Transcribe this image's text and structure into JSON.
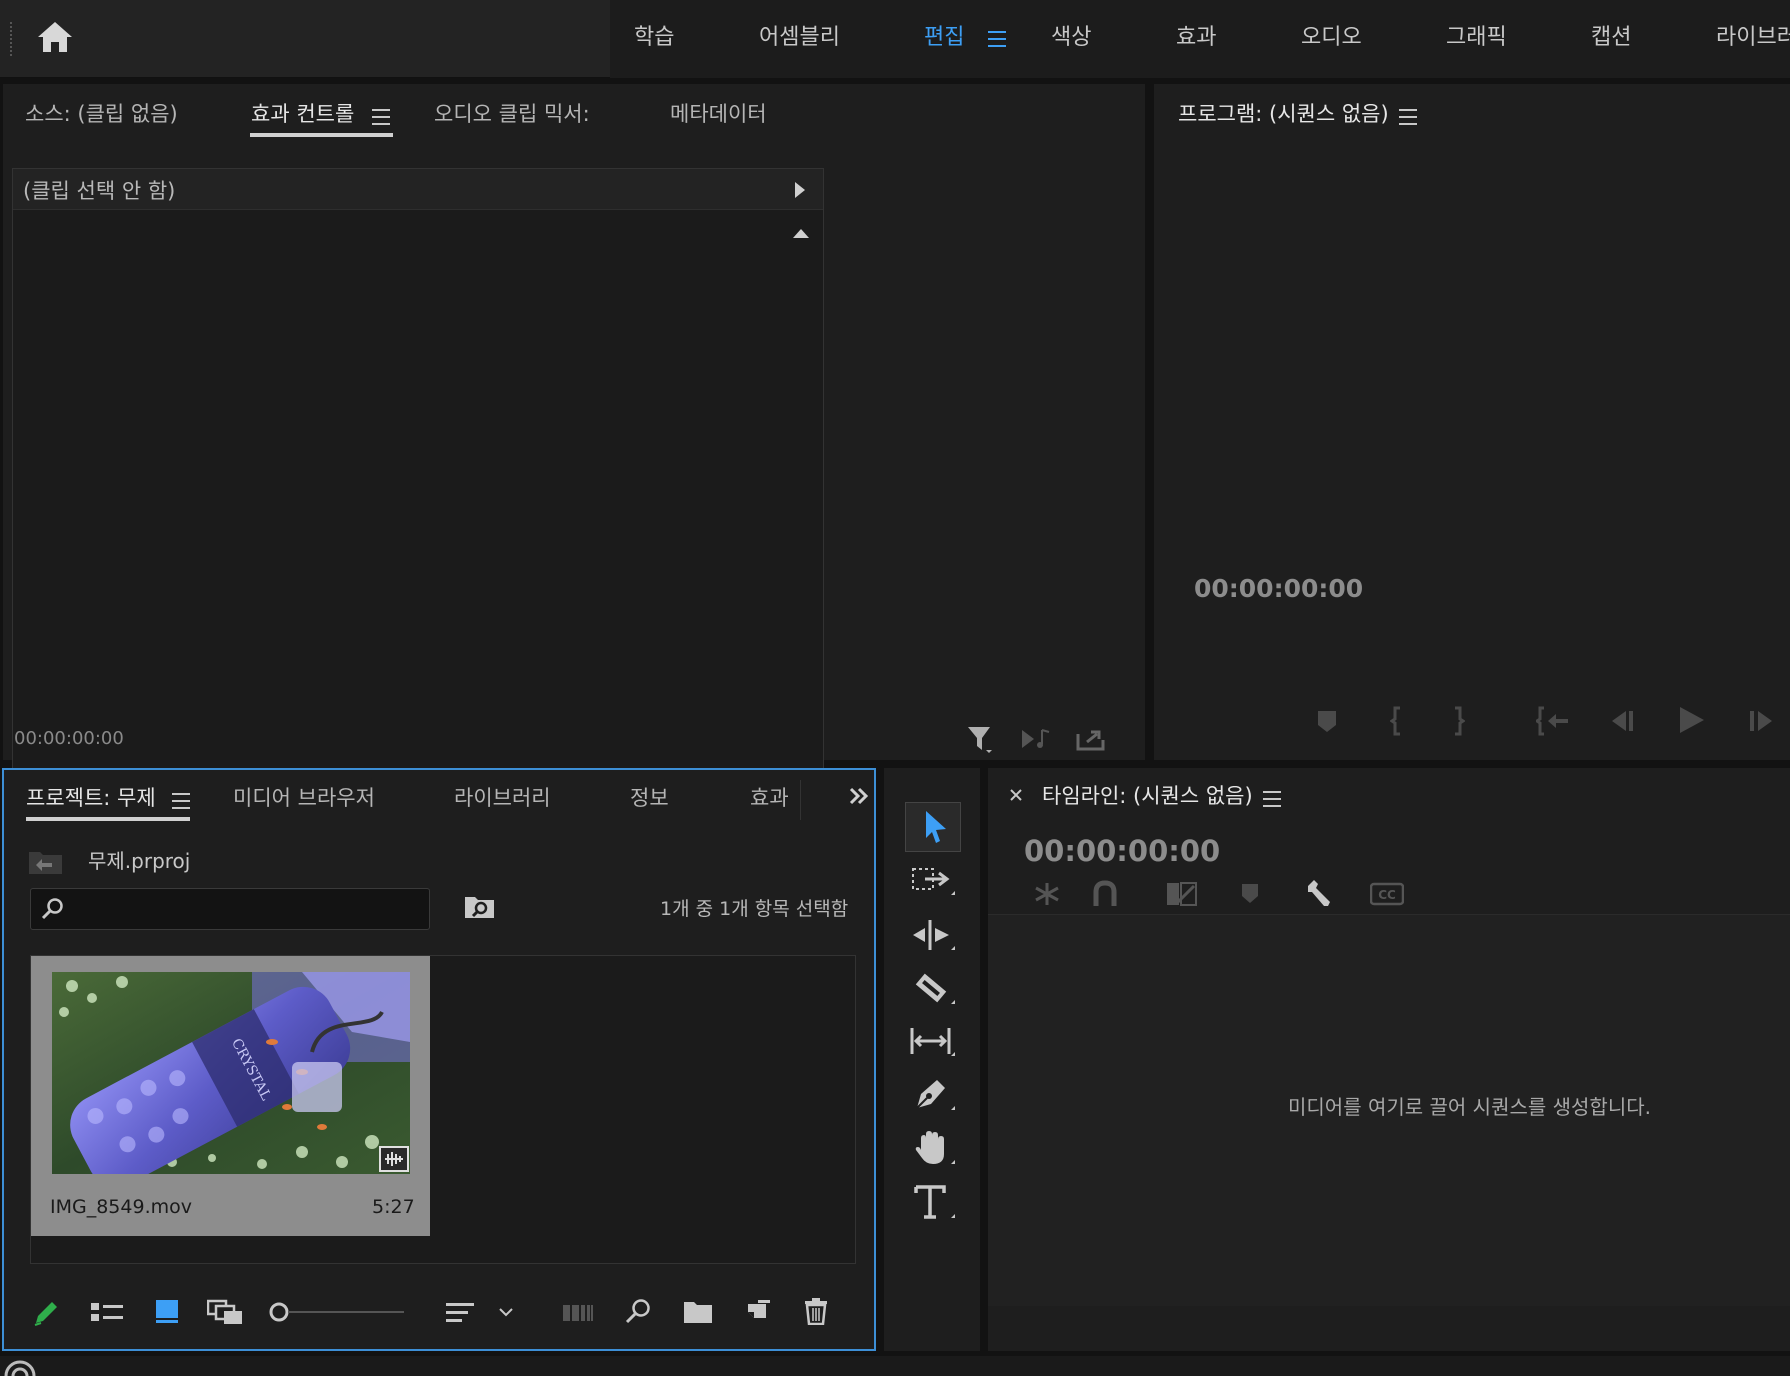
{
  "workspaces": {
    "items": [
      "학습",
      "어셈블리",
      "편집",
      "색상",
      "효과",
      "오디오",
      "그래픽",
      "캡션",
      "라이브러리"
    ],
    "active": "편집"
  },
  "source_panel": {
    "tabs": [
      "소스: (클립 없음)",
      "효과 컨트롤",
      "오디오 클립 믹서:",
      "메타데이터"
    ],
    "active_tab": "효과 컨트롤",
    "clip_header": "(클립 선택 안 함)",
    "timecode": "00:00:00:00"
  },
  "program_panel": {
    "title": "프로그램: (시퀀스 없음)",
    "timecode": "00:00:00:00"
  },
  "project_panel": {
    "tabs": [
      "프로젝트: 무제",
      "미디어 브라우저",
      "라이브러리",
      "정보",
      "효과"
    ],
    "active_tab": "프로젝트: 무제",
    "project_file": "무제.prproj",
    "search_placeholder": "",
    "selection_status": "1개 중 1개 항목 선택함",
    "items": [
      {
        "name": "IMG_8549.mov",
        "duration": "5:27"
      }
    ]
  },
  "timeline_panel": {
    "title": "타임라인: (시퀀스 없음)",
    "timecode": "00:00:00:00",
    "empty_hint": "미디어를 여기로 끌어 시퀀스를 생성합니다."
  },
  "colors": {
    "accent": "#3d9ff5",
    "panel_bg": "#1e1e1e",
    "focus_border": "#3d8fd6",
    "pencil": "#2fae4b"
  },
  "icons": {
    "home": "home-icon",
    "tools": [
      "selection-tool-icon",
      "track-select-forward-icon",
      "ripple-edit-icon",
      "razor-icon",
      "slip-icon",
      "pen-icon",
      "hand-icon",
      "type-icon"
    ]
  }
}
